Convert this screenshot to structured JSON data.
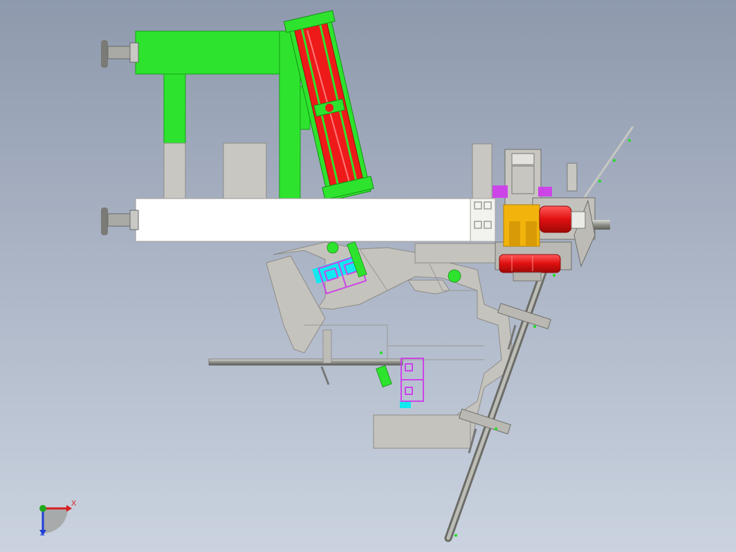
{
  "triad": {
    "x_label": "X",
    "z_label": "Z",
    "x_color": "#d81e1e",
    "y_color": "#1faa1f",
    "z_color": "#1e3fd8"
  },
  "colors": {
    "background_top": "#8e99ad",
    "background_bottom": "#cbd3e0",
    "frame_green": "#2ee32e",
    "cylinder_red": "#ee1a1a",
    "beam_white": "#ffffff",
    "plate_gray": "#c5c3bd",
    "profile_magenta": "#cc44e8",
    "accent_cyan": "#11e8f0",
    "block_yellow": "#f2b40c"
  },
  "parts": [
    "top-green-frame-beam",
    "vertical-green-post",
    "pneumatic-cylinder",
    "white-aluminum-beam",
    "leveling-foot-top",
    "leveling-foot-bottom",
    "gray-base-plate",
    "diagonal-guide-rod",
    "horizontal-rod",
    "aluminum-profile-left",
    "aluminum-profile-right",
    "gripper-head",
    "yellow-motor-block",
    "red-roller-upper",
    "red-roller-lower"
  ]
}
